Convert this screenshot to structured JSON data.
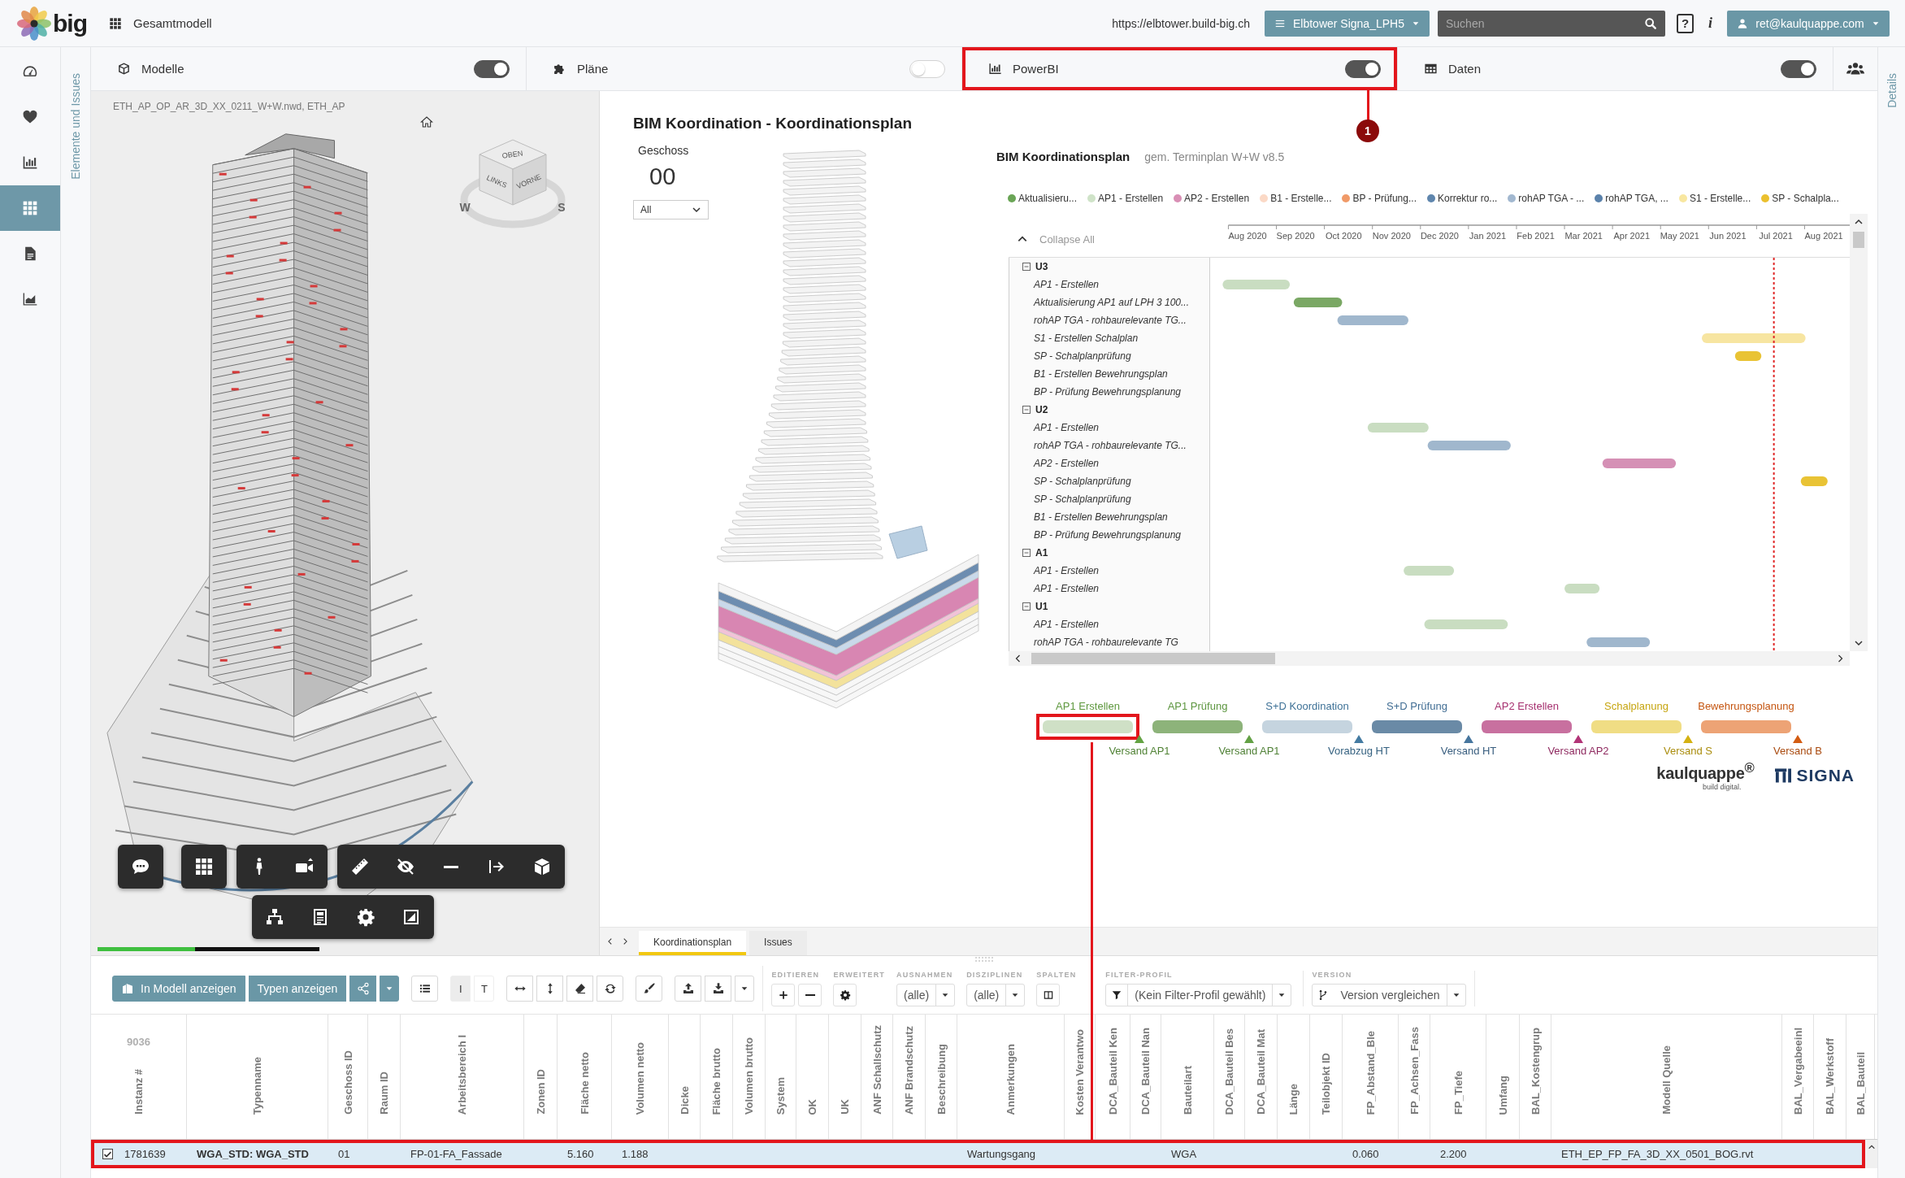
{
  "topbar": {
    "logo": "big",
    "model": "Gesamtmodell",
    "url": "https://elbtower.build-big.ch",
    "project": "Elbtower Signa_LPH5",
    "search": {
      "placeholder": "Suchen"
    },
    "help": "?",
    "info": "i",
    "user": "ret@kaulquappe.com"
  },
  "rail": [
    {
      "selected": false
    },
    {
      "selected": false
    },
    {
      "selected": false
    },
    {
      "selected": true
    },
    {
      "selected": false
    },
    {
      "selected": false
    }
  ],
  "side_tabs": {
    "left": "Elemente und Issues",
    "right": "Details"
  },
  "panels": [
    {
      "title": "Modelle",
      "on": true,
      "highlighted": false
    },
    {
      "title": "Pläne",
      "on": false,
      "highlighted": false
    },
    {
      "title": "PowerBI",
      "on": true,
      "highlighted": true
    },
    {
      "title": "Daten",
      "on": true,
      "highlighted": false
    }
  ],
  "callout": {
    "number": "1"
  },
  "viewer": {
    "file": "ETH_AP_OP_AR_3D_XX_0211_W+W.nwd, ETH_AP",
    "viewcube": {
      "faces": [
        "OBEN",
        "LINKS",
        "VORNE"
      ],
      "compass": [
        "W",
        "S"
      ]
    },
    "loading": {
      "level": 0.44
    }
  },
  "report": {
    "title": "BIM Koordination - Koordinationsplan",
    "floor_filter": {
      "label": "Geschoss",
      "value": "00",
      "select": "All"
    },
    "gantt": {
      "title": "BIM Koordinationsplan",
      "subtitle": "gem. Terminplan W+W v8.5",
      "legend": [
        {
          "label": "Aktualisieru...",
          "color": "#6aa556"
        },
        {
          "label": "AP1 - Erstellen",
          "color": "#cfe3c8"
        },
        {
          "label": "AP2 - Erstellen",
          "color": "#d98fb5"
        },
        {
          "label": "B1 - Erstelle...",
          "color": "#fbd9c6"
        },
        {
          "label": "BP - Prüfung...",
          "color": "#f09a68"
        },
        {
          "label": "Korrektur ro...",
          "color": "#5f86ad"
        },
        {
          "label": "rohAP TGA - ...",
          "color": "#a2b8d0"
        },
        {
          "label": "rohAP TGA, ...",
          "color": "#5b82ab"
        },
        {
          "label": "S1 - Erstelle...",
          "color": "#f8e7a0"
        },
        {
          "label": "SP - Schalpla...",
          "color": "#ebc02e"
        }
      ],
      "collapse_label": "Collapse All",
      "months": [
        "Aug 2020",
        "Sep 2020",
        "Oct 2020",
        "Nov 2020",
        "Dec 2020",
        "Jan 2021",
        "Feb 2021",
        "Mar 2021",
        "Apr 2021",
        "May 2021",
        "Jun 2021",
        "Jul 2021",
        "Aug 2021"
      ],
      "groups": [
        {
          "label": "U3",
          "expanded": true,
          "children": [
            {
              "label": "AP1 - Erstellen",
              "color": "#c9ddc1"
            },
            {
              "label": "Aktualisierung AP1 auf LPH 3 100...",
              "color": "#7aa864"
            },
            {
              "label": "rohAP TGA - rohbaurelevante TG...",
              "color": "#a0b7cd"
            },
            {
              "label": "S1 - Erstellen Schalplan",
              "color": "#f7e5a1"
            },
            {
              "label": "SP - Schalplanprüfung",
              "color": "#e9c335"
            },
            {
              "label": "B1 - Erstellen Bewehrungsplan"
            },
            {
              "label": "BP - Prüfung Bewehrungsplanung"
            }
          ]
        },
        {
          "label": "U2",
          "expanded": true,
          "children": [
            {
              "label": "AP1 - Erstellen",
              "color": "#c9ddc1"
            },
            {
              "label": "rohAP TGA - rohbaurelevante TG...",
              "color": "#a0b7cd"
            },
            {
              "label": "AP2 - Erstellen",
              "color": "#d590b5"
            },
            {
              "label": "SP - Schalplanprüfung",
              "color": "#e9c335"
            },
            {
              "label": "SP - Schalplanprüfung"
            },
            {
              "label": "B1 - Erstellen Bewehrungsplan"
            },
            {
              "label": "BP - Prüfung Bewehrungsplanung"
            }
          ]
        },
        {
          "label": "A1",
          "expanded": true,
          "children": [
            {
              "label": "AP1 - Erstellen",
              "color": "#c9ddc1"
            },
            {
              "label": "AP1 - Erstellen",
              "color": "#c9ddc1"
            }
          ]
        },
        {
          "label": "U1",
          "expanded": true,
          "children": [
            {
              "label": "AP1 - Erstellen",
              "color": "#c9ddc1"
            },
            {
              "label": "rohAP TGA - rohbaurelevante TG",
              "color": "#a0b7cd"
            }
          ]
        }
      ]
    },
    "phases": [
      {
        "label": "AP1 Erstellen",
        "milestone": "Versand AP1",
        "color": "#cfe0c6",
        "highlighted": true
      },
      {
        "label": "AP1 Prüfung",
        "milestone": "Versand AP1",
        "color": "#8db37a",
        "highlighted": false
      },
      {
        "label": "S+D Koordination",
        "milestone": "Vorabzug HT",
        "color": "#c5d4df",
        "highlighted": false
      },
      {
        "label": "S+D Prüfung",
        "milestone": "Versand HT",
        "color": "#6a8aa6",
        "highlighted": false
      },
      {
        "label": "AP2 Erstellen",
        "milestone": "Versand AP2",
        "color": "#c8709f",
        "highlighted": false
      },
      {
        "label": "Schalplanung",
        "milestone": "Versand S",
        "color": "#f0dd84",
        "highlighted": false
      },
      {
        "label": "Bewehrungsplanung",
        "milestone": "Versand B",
        "color": "#eda375",
        "highlighted": false
      }
    ],
    "logos": {
      "primary": "kaulquappe$^{®}$",
      "tagline": "build digital.",
      "secondary": "SIGNA"
    },
    "tabs": [
      {
        "label": "Koordinationsplan",
        "selected": true
      },
      {
        "label": "Issues",
        "selected": false
      }
    ]
  },
  "data": {
    "toolbar": {
      "show_in_model": "In Modell anzeigen",
      "show_types": "Typen anzeigen",
      "modes": [
        {
          "label": "I",
          "selected": true
        },
        {
          "label": "T",
          "selected": false
        }
      ],
      "sections": [
        {
          "label": "EDITIEREN",
          "kind": "edit"
        },
        {
          "label": "ERWEITERT",
          "kind": "settings"
        },
        {
          "label": "AUSNAHMEN",
          "kind": "select",
          "value": "(alle)"
        },
        {
          "label": "DISZIPLINEN",
          "kind": "select",
          "value": "(alle)"
        },
        {
          "label": "SPALTEN",
          "kind": "columns"
        },
        {
          "label": "FILTER-PROFIL",
          "kind": "filter",
          "value": "(Kein Filter-Profil gewählt)"
        },
        {
          "label": "VERSION",
          "kind": "version",
          "value": "Version vergleichen"
        }
      ]
    },
    "count": "9036",
    "columns": [
      "Instanz #",
      "Typenname",
      "Geschoss ID",
      "Raum ID",
      "Arbeitsbereich I",
      "Zonen ID",
      "Fläche netto",
      "Volumen netto",
      "Dicke",
      "Fläche brutto",
      "Volumen brutto",
      "System",
      "OK",
      "UK",
      "ANF Schallschutz",
      "ANF Brandschutz",
      "Beschreibung",
      "Anmerkungen",
      "Kosten Verantwo",
      "DCA_Bauteil Ken",
      "DCA_Bauteil Nan",
      "Bauteilart",
      "DCA_Bauteil Bes",
      "DCA_Bauteil Mat",
      "Länge",
      "Teilobjekt ID",
      "FP_Abstand_Ble",
      "FP_Achsen_Fass",
      "FP_Tiefe",
      "Umfang",
      "BAL_Kostengrup",
      "Modell Quelle",
      "BAL_Vergabeeinl",
      "BAL_Werkstoff",
      "BAL_Bauteil"
    ],
    "rows": [
      {
        "checked": true,
        "selected": true,
        "highlighted": true,
        "cells": [
          "1781639",
          "WGA_STD: WGA_STD",
          "01",
          null,
          "FP-01-FA_Fassade",
          null,
          "5.160",
          "1.188",
          null,
          null,
          null,
          null,
          null,
          null,
          null,
          null,
          null,
          "Wartungsgang",
          null,
          null,
          null,
          "WGA",
          null,
          null,
          null,
          null,
          "0.060",
          null,
          "2.200",
          null,
          null,
          "ETH_EP_FP_FA_3D_XX_0501_BOG.rvt",
          null,
          null,
          null
        ]
      }
    ]
  }
}
